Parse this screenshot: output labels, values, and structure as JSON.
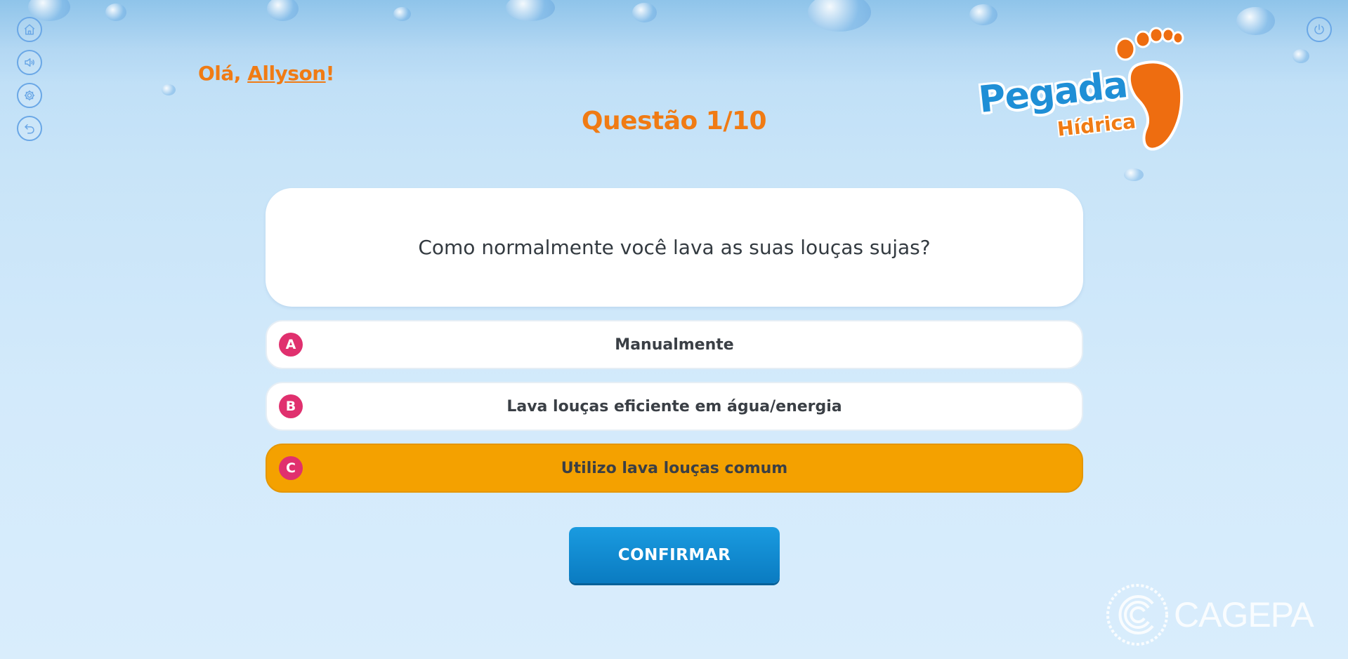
{
  "header": {
    "greeting_prefix": "Olá, ",
    "user_name": "Allyson",
    "greeting_suffix": "!",
    "question_counter": "Questão 1/10"
  },
  "logo": {
    "title": "Pegada",
    "subtitle": "Hídrica"
  },
  "side_menu": [
    {
      "name": "home",
      "icon": "home-icon"
    },
    {
      "name": "sound",
      "icon": "speaker-icon"
    },
    {
      "name": "settings",
      "icon": "gear-icon"
    },
    {
      "name": "back",
      "icon": "back-arrow-icon"
    }
  ],
  "power_icon": "power-icon",
  "question": {
    "text": "Como normalmente você lava as suas louças sujas?"
  },
  "options": [
    {
      "letter": "A",
      "label": "Manualmente",
      "selected": false
    },
    {
      "letter": "B",
      "label": "Lava louças eficiente em água/energia",
      "selected": false
    },
    {
      "letter": "C",
      "label": "Utilizo lava louças comum",
      "selected": true
    }
  ],
  "confirm_label": "CONFIRMAR",
  "footer": {
    "brand": "CAGEPA"
  },
  "colors": {
    "accent_orange": "#f07b14",
    "selected_option": "#f4a100",
    "letter_badge": "#e0306e",
    "confirm_button": "#0a7bc1",
    "icon_outline": "#6aa7e6"
  }
}
